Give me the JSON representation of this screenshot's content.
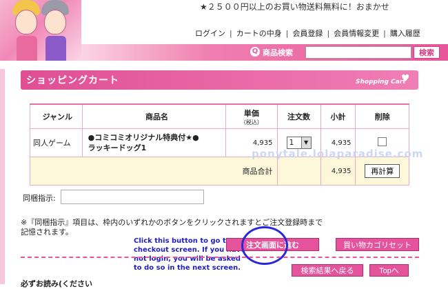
{
  "header": {
    "promo": "★２５００円以上のお買い物送料無料に！おまかせ",
    "nav": [
      "ログイン",
      "カートの中身",
      "会員登録",
      "会員情報変更",
      "購入履歴"
    ],
    "search_label": "商品検索",
    "search_value": "",
    "search_button": "検索"
  },
  "cart": {
    "title": "ショッピングカート",
    "subtitle": "Shopping Cart",
    "columns": {
      "genre": "ジャンル",
      "product": "商品名",
      "price": "単価",
      "price_sub": "（税込）",
      "qty": "注文数",
      "subtotal": "小計",
      "delete": "削除"
    },
    "items": [
      {
        "genre": "同人ゲーム",
        "product_line1": "●コミコミオリジナル特典付★●",
        "product_line2": "ラッキードッグ1",
        "price": "4,935",
        "qty": "1",
        "subtotal": "4,935"
      }
    ],
    "total_label": "商品合計",
    "total_value": "4,935",
    "recalc_button": "再計算"
  },
  "watermark": "ponytale.lolaparadise.com",
  "bundle": {
    "label": "同梱指示:",
    "value": ""
  },
  "note": "※『同梱指示』項目は、枠内のいずれかのボタンをクリックされますとご注文登録時まで　記憶されます。",
  "annotation": "Click this button to go to checkout screen. If you have not login, you will be asked to do so in the next screen.",
  "buttons": {
    "order": "注文画面に進む",
    "reset": "買い物カゴリセット",
    "back": "検索結果へ戻る",
    "top": "Topへ"
  },
  "must_read": "必ずお読み(ください"
}
